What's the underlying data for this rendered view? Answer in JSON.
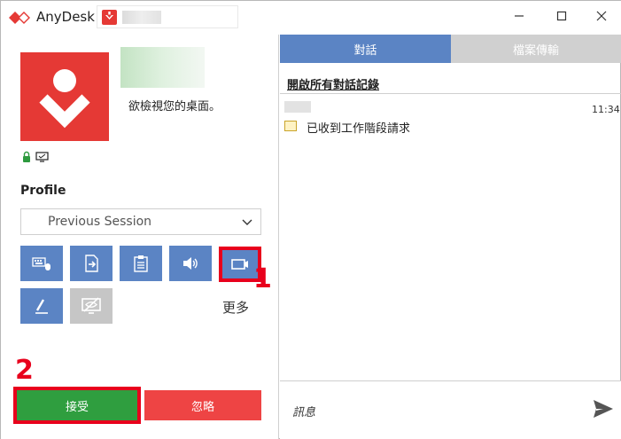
{
  "titlebar": {
    "app_title": "AnyDesk",
    "minimize_icon": "minimize-icon",
    "maximize_icon": "maximize-icon",
    "close_icon": "close-icon"
  },
  "left": {
    "request_text": "欲檢視您的桌面。",
    "profile_label": "Profile",
    "profile_select": "Previous Session",
    "permissions": [
      {
        "icon": "keyboard-mouse-icon"
      },
      {
        "icon": "file-transfer-icon"
      },
      {
        "icon": "clipboard-icon"
      },
      {
        "icon": "sound-icon"
      },
      {
        "icon": "camera-icon"
      },
      {
        "icon": "pen-icon"
      },
      {
        "icon": "screen-privacy-icon"
      }
    ],
    "more_label": "更多",
    "accept_label": "接受",
    "dismiss_label": "忽略",
    "annotation_1": "1",
    "annotation_2": "2"
  },
  "right": {
    "tabs": [
      {
        "label": "對話"
      },
      {
        "label": "檔案傳輸"
      }
    ],
    "history_link": "開啟所有對話記錄",
    "chat": {
      "time": "11:34",
      "message": "已收到工作階段請求"
    },
    "message_placeholder": "訊息"
  },
  "colors": {
    "brand_red": "#e53935",
    "blue": "#5b84c4",
    "accept_green": "#2f9e3f",
    "dismiss_red": "#ee4444",
    "annotation_red": "#e8001c"
  }
}
